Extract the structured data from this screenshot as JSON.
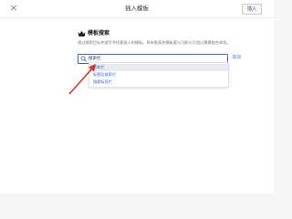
{
  "dialog": {
    "title": "插入模板",
    "insert_label": "插入"
  },
  "section": {
    "title": "模板搜索",
    "description": "通过搜索目标关键字寻找要插入的模板。再有据表述模板要与可能与可组以模模配合本机。"
  },
  "search": {
    "value": "搜索栏",
    "cancel_label": "取消"
  },
  "dropdown": {
    "items": [
      {
        "label": "智能栏"
      },
      {
        "label": "标题及搜索栏"
      },
      {
        "label": "搜题标签栏"
      }
    ]
  },
  "colors": {
    "accent": "#3b67d9",
    "annotation_arrow": "#e0302b"
  }
}
